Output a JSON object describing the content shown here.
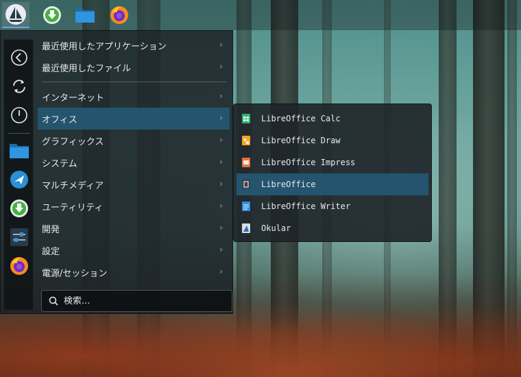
{
  "top_panel": {
    "buttons": [
      {
        "name": "sailboat-menu-icon"
      },
      {
        "name": "download-icon"
      },
      {
        "name": "folder-icon"
      },
      {
        "name": "firefox-icon"
      }
    ]
  },
  "favorites": {
    "items": [
      "back-arrow-icon",
      "refresh-icon",
      "power-icon",
      "folder-icon",
      "plane-icon",
      "download-icon",
      "settings-icon",
      "firefox-icon"
    ]
  },
  "categories": [
    {
      "label": "最近使用したアプリケーション"
    },
    {
      "label": "最近使用したファイル"
    },
    {
      "label": "インターネット"
    },
    {
      "label": "オフィス"
    },
    {
      "label": "グラフィックス"
    },
    {
      "label": "システム"
    },
    {
      "label": "マルチメディア"
    },
    {
      "label": "ユーティリティ"
    },
    {
      "label": "開発"
    },
    {
      "label": "設定"
    },
    {
      "label": "電源/セッション"
    }
  ],
  "chevron": "›",
  "search": {
    "placeholder": "検索..."
  },
  "submenu": {
    "items": [
      {
        "label": "LibreOffice Calc",
        "icon": "calc-icon",
        "color": "#2bb673"
      },
      {
        "label": "LibreOffice Draw",
        "icon": "draw-icon",
        "color": "#f5a623"
      },
      {
        "label": "LibreOffice Impress",
        "icon": "impress-icon",
        "color": "#e8713c"
      },
      {
        "label": "LibreOffice",
        "icon": "libreoffice-icon",
        "color": "#3c4146"
      },
      {
        "label": "LibreOffice Writer",
        "icon": "writer-icon",
        "color": "#2d8fe0"
      },
      {
        "label": "Okular",
        "icon": "okular-icon",
        "color": "#d7dde3"
      }
    ]
  },
  "colors": {
    "highlight": "#24546e",
    "accent": "#6aa7d6"
  }
}
